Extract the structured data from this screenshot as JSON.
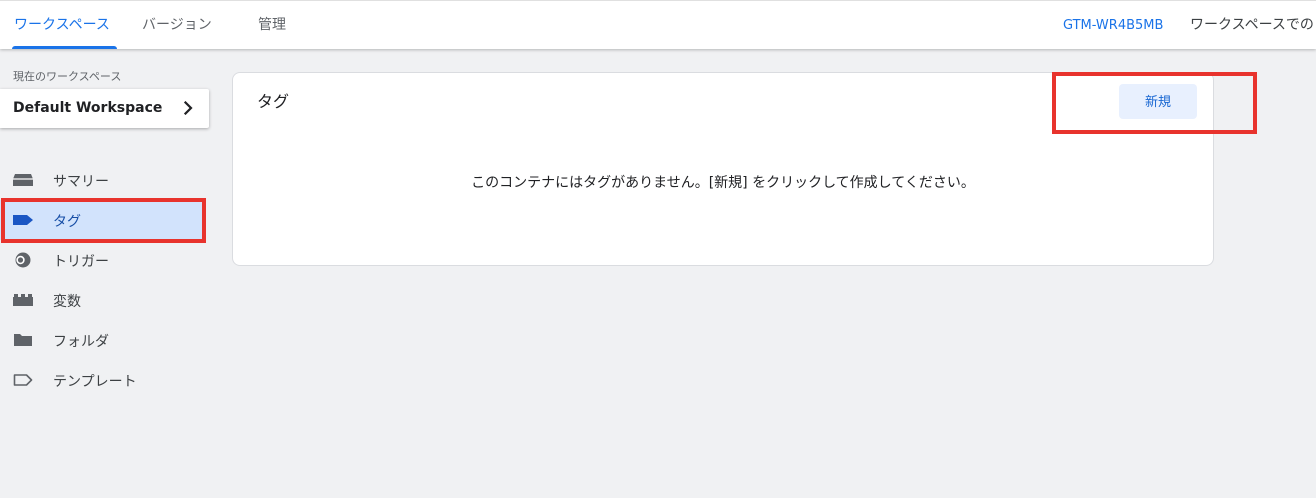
{
  "header": {
    "tabs": [
      {
        "label": "ワークスペース",
        "active": true
      },
      {
        "label": "バージョン",
        "active": false
      },
      {
        "label": "管理",
        "active": false
      }
    ],
    "container_id": "GTM-WR4B5MB",
    "workspace_changes_label": "ワークスペースでの"
  },
  "sidebar": {
    "workspace_caption": "現在のワークスペース",
    "workspace_name": "Default Workspace",
    "items": [
      {
        "label": "サマリー",
        "icon": "overview-icon",
        "active": false
      },
      {
        "label": "タグ",
        "icon": "tag-icon",
        "active": true
      },
      {
        "label": "トリガー",
        "icon": "trigger-icon",
        "active": false
      },
      {
        "label": "変数",
        "icon": "variables-icon",
        "active": false
      },
      {
        "label": "フォルダ",
        "icon": "folder-icon",
        "active": false
      },
      {
        "label": "テンプレート",
        "icon": "template-icon",
        "active": false
      }
    ]
  },
  "main": {
    "card_title": "タグ",
    "new_button_label": "新規",
    "empty_message": "このコンテナにはタグがありません。[新規] をクリックして作成してください。"
  },
  "colors": {
    "accent": "#1a73e8",
    "active_nav_bg": "#d2e3fc",
    "highlight_red": "#e8332d"
  }
}
